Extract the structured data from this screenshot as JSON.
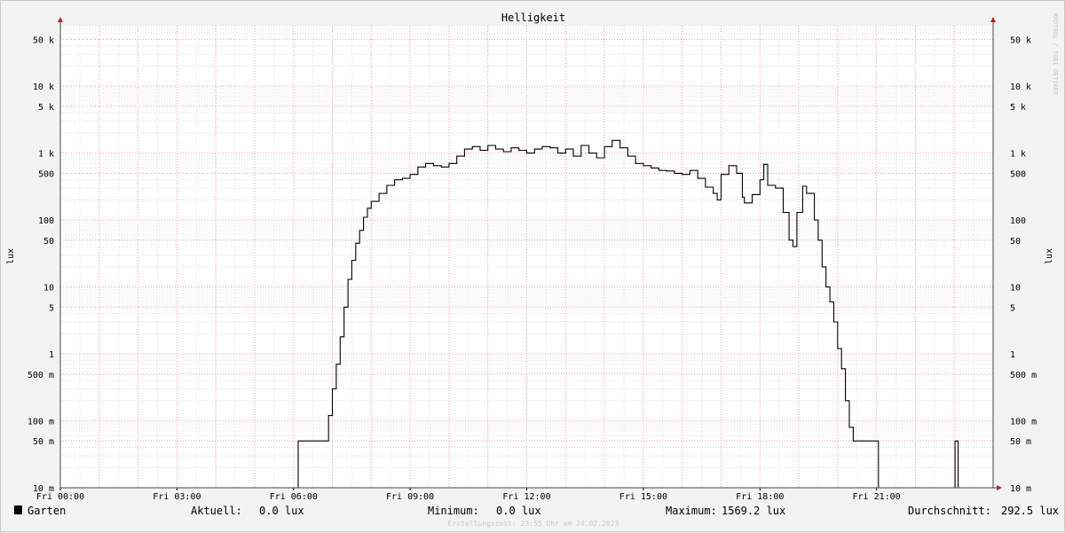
{
  "chart_data": {
    "type": "line",
    "title": "Helligkeit",
    "ylabel": "lux",
    "yscale": "log",
    "ylim": [
      0.01,
      80000
    ],
    "x_ticks": [
      "Fri 00:00",
      "Fri 03:00",
      "Fri 06:00",
      "Fri 09:00",
      "Fri 12:00",
      "Fri 15:00",
      "Fri 18:00",
      "Fri 21:00"
    ],
    "xlim_hours": [
      0,
      24
    ],
    "y_ticks": [
      {
        "v": 50000,
        "label": "50 k"
      },
      {
        "v": 10000,
        "label": "10 k"
      },
      {
        "v": 5000,
        "label": "5 k"
      },
      {
        "v": 1000,
        "label": "1 k"
      },
      {
        "v": 500,
        "label": "500"
      },
      {
        "v": 100,
        "label": "100"
      },
      {
        "v": 50,
        "label": "50"
      },
      {
        "v": 10,
        "label": "10"
      },
      {
        "v": 5,
        "label": "5"
      },
      {
        "v": 1,
        "label": "1"
      },
      {
        "v": 0.5,
        "label": "500 m"
      },
      {
        "v": 0.1,
        "label": "100 m"
      },
      {
        "v": 0.05,
        "label": "50 m"
      },
      {
        "v": 0.01,
        "label": "10 m"
      }
    ],
    "series": [
      {
        "name": "Garten",
        "color": "#000000",
        "points": [
          [
            0.0,
            0.01
          ],
          [
            6.1,
            0.01
          ],
          [
            6.12,
            0.05
          ],
          [
            6.8,
            0.05
          ],
          [
            6.9,
            0.12
          ],
          [
            7.0,
            0.3
          ],
          [
            7.1,
            0.7
          ],
          [
            7.2,
            1.8
          ],
          [
            7.3,
            5
          ],
          [
            7.4,
            13
          ],
          [
            7.5,
            25
          ],
          [
            7.6,
            45
          ],
          [
            7.7,
            70
          ],
          [
            7.8,
            110
          ],
          [
            7.9,
            150
          ],
          [
            8.0,
            190
          ],
          [
            8.2,
            250
          ],
          [
            8.4,
            330
          ],
          [
            8.6,
            400
          ],
          [
            8.8,
            420
          ],
          [
            9.0,
            480
          ],
          [
            9.2,
            620
          ],
          [
            9.4,
            700
          ],
          [
            9.6,
            650
          ],
          [
            9.8,
            620
          ],
          [
            10.0,
            700
          ],
          [
            10.2,
            900
          ],
          [
            10.4,
            1150
          ],
          [
            10.6,
            1250
          ],
          [
            10.8,
            1100
          ],
          [
            11.0,
            1300
          ],
          [
            11.2,
            1150
          ],
          [
            11.4,
            1050
          ],
          [
            11.6,
            1200
          ],
          [
            11.8,
            1100
          ],
          [
            12.0,
            1000
          ],
          [
            12.2,
            1150
          ],
          [
            12.4,
            1250
          ],
          [
            12.6,
            1200
          ],
          [
            12.8,
            1000
          ],
          [
            13.0,
            1150
          ],
          [
            13.2,
            900
          ],
          [
            13.4,
            1300
          ],
          [
            13.6,
            1000
          ],
          [
            13.8,
            850
          ],
          [
            14.0,
            1250
          ],
          [
            14.2,
            1550
          ],
          [
            14.4,
            1200
          ],
          [
            14.6,
            900
          ],
          [
            14.8,
            700
          ],
          [
            15.0,
            650
          ],
          [
            15.2,
            600
          ],
          [
            15.4,
            550
          ],
          [
            15.6,
            540
          ],
          [
            15.8,
            500
          ],
          [
            16.0,
            480
          ],
          [
            16.2,
            550
          ],
          [
            16.4,
            420
          ],
          [
            16.6,
            310
          ],
          [
            16.8,
            250
          ],
          [
            16.9,
            200
          ],
          [
            17.0,
            480
          ],
          [
            17.2,
            650
          ],
          [
            17.4,
            500
          ],
          [
            17.55,
            220
          ],
          [
            17.6,
            180
          ],
          [
            17.8,
            240
          ],
          [
            18.0,
            400
          ],
          [
            18.1,
            680
          ],
          [
            18.2,
            330
          ],
          [
            18.4,
            300
          ],
          [
            18.6,
            130
          ],
          [
            18.75,
            50
          ],
          [
            18.85,
            40
          ],
          [
            18.95,
            130
          ],
          [
            19.1,
            320
          ],
          [
            19.2,
            250
          ],
          [
            19.4,
            100
          ],
          [
            19.5,
            50
          ],
          [
            19.6,
            20
          ],
          [
            19.7,
            10
          ],
          [
            19.8,
            6
          ],
          [
            19.9,
            3
          ],
          [
            20.0,
            1.2
          ],
          [
            20.1,
            0.6
          ],
          [
            20.2,
            0.2
          ],
          [
            20.3,
            0.08
          ],
          [
            20.4,
            0.05
          ],
          [
            21.0,
            0.05
          ],
          [
            21.05,
            0.01
          ],
          [
            23.0,
            0.01
          ],
          [
            23.02,
            0.05
          ],
          [
            23.08,
            0.05
          ],
          [
            23.1,
            0.01
          ],
          [
            24.0,
            0.01
          ]
        ]
      }
    ]
  },
  "footer": {
    "legend_label": "Garten",
    "current_label": "Aktuell:",
    "current_value": "0.0 lux",
    "min_label": "Minimum:",
    "min_value": "0.0 lux",
    "max_label": "Maximum:",
    "max_value": "1569.2 lux",
    "avg_label": "Durchschnitt:",
    "avg_value": "292.5 lux",
    "timestamp": "Erstellungszeit: 23:55 Uhr am 24.02.2023",
    "side_text": "RRDTOOL / TOBI OETIKER"
  }
}
